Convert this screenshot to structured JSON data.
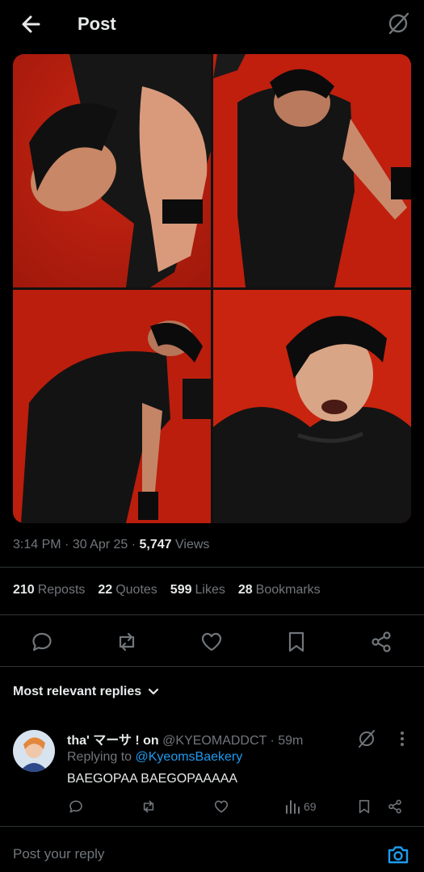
{
  "header": {
    "title": "Post",
    "back_icon": "back-arrow-icon",
    "grok_icon": "grok-icon"
  },
  "post": {
    "time": "3:14 PM",
    "date": "30 Apr 25",
    "views_count": "5,747",
    "views_label": "Views",
    "media_alt": [
      "Photo 1",
      "Photo 2",
      "Photo 3",
      "Photo 4"
    ]
  },
  "stats": [
    {
      "count": "210",
      "label": "Reposts"
    },
    {
      "count": "22",
      "label": "Quotes"
    },
    {
      "count": "599",
      "label": "Likes"
    },
    {
      "count": "28",
      "label": "Bookmarks"
    }
  ],
  "actions": [
    "reply-icon",
    "repost-icon",
    "like-icon",
    "bookmark-icon",
    "share-icon"
  ],
  "replies": {
    "sort_label": "Most relevant replies",
    "items": [
      {
        "display_name": "tha' マーサ ! on",
        "handle": "@KYEOMADDCT",
        "time": "59m",
        "replying_prefix": "Replying to",
        "replying_to": "@KyeomsBaekery",
        "text": "BAEGOPAA BAEGOPAAAAA",
        "views": "69"
      }
    ]
  },
  "composer": {
    "placeholder": "Post your reply"
  },
  "colors": {
    "background": "#000000",
    "text": "#e7e9ea",
    "muted": "#71767b",
    "link": "#1d9bf0",
    "divider": "#2f3336",
    "photo_bg": "#c3200f"
  }
}
